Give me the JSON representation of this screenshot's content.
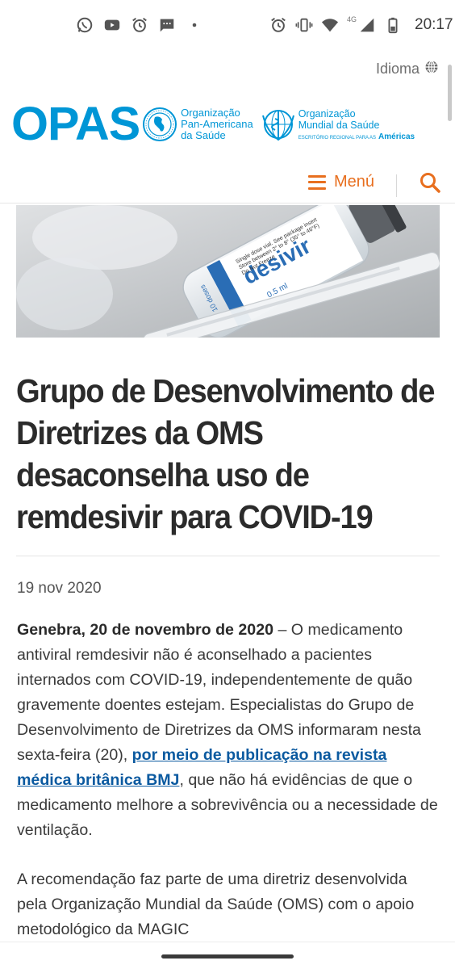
{
  "status_bar": {
    "time": "20:17",
    "network": "4G",
    "left_icons": [
      "whatsapp-icon",
      "youtube-icon",
      "alarm-icon",
      "message-icon",
      "dot-icon"
    ],
    "right_icons": [
      "alarm-icon",
      "vibrate-icon",
      "wifi-icon",
      "signal-icon",
      "battery-icon"
    ]
  },
  "header": {
    "language_label": "Idioma",
    "brand": "OPAS",
    "paho_name_lines": [
      "Organização",
      "Pan-Americana",
      "da Saúde"
    ],
    "who_name_lines": [
      "Organização",
      "Mundial da Saúde"
    ],
    "who_sub_small": "ESCRITÓRIO REGIONAL PARA AS",
    "who_sub_bold": "Américas",
    "menu_label": "Menú"
  },
  "colors": {
    "brand_blue": "#0096d6",
    "accent_orange": "#e86f1f",
    "link_blue": "#0b5aa0"
  },
  "article": {
    "title": "Grupo de Desenvolvimento de Diretrizes da OMS desaconselha uso de remdesivir para COVID-19",
    "date": "19 nov 2020",
    "p1_dateline": "Genebra, 20 de novembro de 2020",
    "p1_text_a": " – O medicamento antiviral remdesivir não é aconselhado a pacientes internados com COVID-19, independentemente de quão gravemente doentes estejam. Especialistas do Grupo de Desenvolvimento de Diretrizes da OMS informaram nesta sexta-feira (20), ",
    "p1_link": "por meio de publicação na revista médica britânica BMJ",
    "p1_text_b": ", que não há evidências de que o medicamento melhore a sobrevivência ou a necessidade de ventilação.",
    "p2_text": "A recomendação faz parte de uma diretriz desenvolvida pela Organização Mundial da Saúde (OMS) com o apoio metodológico da MAGIC"
  },
  "hero_image": {
    "vial_label_brand": "desivir",
    "vial_dose": "10 doses",
    "vial_volume": "0.5 ml",
    "vial_text_lines": [
      "Single dose vial. See package insert",
      "Store between 2° to 8° (35° to 46°F)",
      "Do Not Freeze"
    ]
  }
}
